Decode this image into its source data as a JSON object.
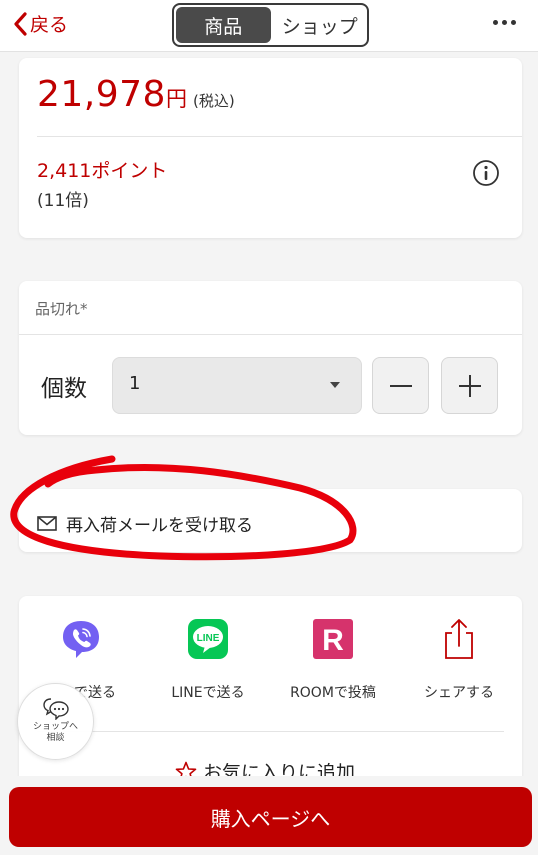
{
  "header": {
    "back_label": "戻る",
    "tabs": [
      {
        "label": "商品",
        "active": true
      },
      {
        "label": "ショップ",
        "active": false
      }
    ]
  },
  "price_card": {
    "price": "21,978",
    "currency": "円",
    "tax_note": "(税込)",
    "points": "2,411ポイント",
    "multiplier": "(11倍)"
  },
  "quantity_card": {
    "stock_status": "品切れ*",
    "quantity_label": "個数",
    "quantity_value": "1"
  },
  "restock": {
    "label": "再入荷メールを受け取る"
  },
  "share": {
    "items": [
      {
        "label": "で送る",
        "icon": "viber-icon"
      },
      {
        "label": "LINEで送る",
        "icon": "line-icon"
      },
      {
        "label": "ROOMで投稿",
        "icon": "room-icon"
      },
      {
        "label": "シェアする",
        "icon": "share-icon"
      }
    ],
    "line_icon_text": "LINE",
    "room_icon_text": "R",
    "favorite_label": "お気に入りに追加"
  },
  "consult": {
    "line1": "ショップへ",
    "line2": "相談"
  },
  "buy_button": "購入ページへ",
  "colors": {
    "brand_red": "#bf0000",
    "viber": "#7360f2",
    "line": "#06c755",
    "room": "#d6336c"
  }
}
